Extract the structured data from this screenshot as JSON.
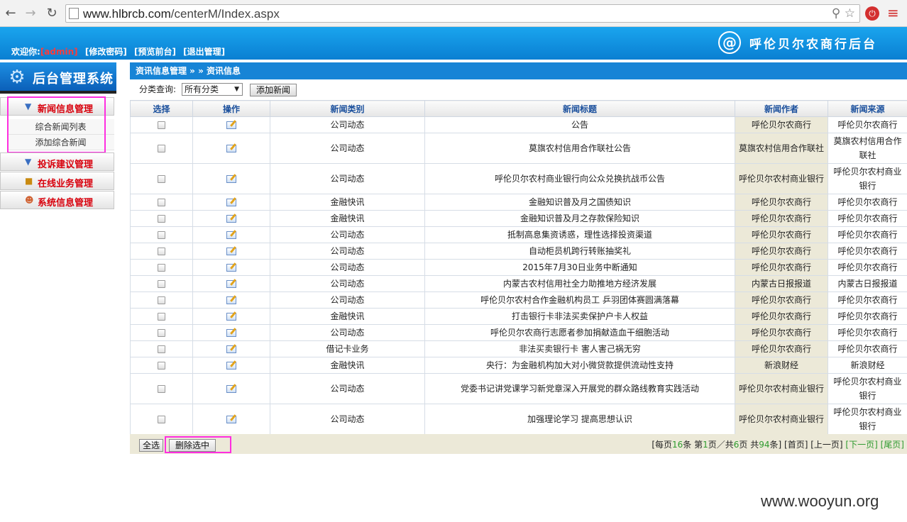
{
  "browser": {
    "url_host": "www.hlbrcb.com",
    "url_path": "/centerM/Index.aspx"
  },
  "header": {
    "welcome_label": "欢迎你:",
    "user_name": "[admin]",
    "links": [
      "[修改密码]",
      "[预览前台]",
      "[退出管理]"
    ],
    "brand_text": "呼伦贝尔农商行后台"
  },
  "sidebar": {
    "title": "后台管理系统",
    "categories": [
      {
        "label": "新闻信息管理",
        "icon": "news-icon"
      },
      {
        "label": "投诉建议管理",
        "icon": "complaint-icon"
      },
      {
        "label": "在线业务管理",
        "icon": "business-icon"
      },
      {
        "label": "系统信息管理",
        "icon": "user-icon"
      }
    ],
    "sub_items": [
      "综合新闻列表",
      "添加综合新闻"
    ]
  },
  "main": {
    "breadcrumb": "资讯信息管理 » » 资讯信息",
    "filter_label": "分类查询:",
    "filter_value": "所有分类",
    "add_button": "添加新闻",
    "columns": [
      "选择",
      "操作",
      "新闻类别",
      "新闻标题",
      "新闻作者",
      "新闻来源"
    ],
    "rows": [
      {
        "category": "公司动态",
        "title": "公告",
        "author": "呼伦贝尔农商行",
        "source": "呼伦贝尔农商行"
      },
      {
        "category": "公司动态",
        "title": "莫旗农村信用合作联社公告",
        "author": "莫旗农村信用合作联社",
        "source": "莫旗农村信用合作联社"
      },
      {
        "category": "公司动态",
        "title": "呼伦贝尔农村商业银行向公众兑换抗战币公告",
        "author": "呼伦贝尔农村商业银行",
        "source": "呼伦贝尔农村商业银行"
      },
      {
        "category": "金融快讯",
        "title": "金融知识普及月之国债知识",
        "author": "呼伦贝尔农商行",
        "source": "呼伦贝尔农商行"
      },
      {
        "category": "金融快讯",
        "title": "金融知识普及月之存款保险知识",
        "author": "呼伦贝尔农商行",
        "source": "呼伦贝尔农商行"
      },
      {
        "category": "公司动态",
        "title": "抵制高息集资诱惑，理性选择投资渠道",
        "author": "呼伦贝尔农商行",
        "source": "呼伦贝尔农商行"
      },
      {
        "category": "公司动态",
        "title": "自动柜员机跨行转账抽奖礼",
        "author": "呼伦贝尔农商行",
        "source": "呼伦贝尔农商行"
      },
      {
        "category": "公司动态",
        "title": "2015年7月30日业务中断通知",
        "author": "呼伦贝尔农商行",
        "source": "呼伦贝尔农商行"
      },
      {
        "category": "公司动态",
        "title": "内蒙古农村信用社全力助推地方经济发展",
        "author": "内蒙古日报报道",
        "source": "内蒙古日报报道"
      },
      {
        "category": "公司动态",
        "title": "呼伦贝尔农村合作金融机构员工 乒羽团体赛圆满落幕",
        "author": "呼伦贝尔农商行",
        "source": "呼伦贝尔农商行"
      },
      {
        "category": "金融快讯",
        "title": "打击银行卡非法买卖保护户卡人权益",
        "author": "呼伦贝尔农商行",
        "source": "呼伦贝尔农商行"
      },
      {
        "category": "公司动态",
        "title": "呼伦贝尔农商行志愿者参加捐献造血干细胞活动",
        "author": "呼伦贝尔农商行",
        "source": "呼伦贝尔农商行"
      },
      {
        "category": "借记卡业务",
        "title": "非法买卖银行卡 害人害己祸无穷",
        "author": "呼伦贝尔农商行",
        "source": "呼伦贝尔农商行"
      },
      {
        "category": "金融快讯",
        "title": "央行：为金融机构加大对小微贷款提供流动性支持",
        "author": "新浪财经",
        "source": "新浪财经"
      },
      {
        "category": "公司动态",
        "title": "党委书记讲党课学习新党章深入开展党的群众路线教育实践活动",
        "author": "呼伦贝尔农村商业银行",
        "source": "呼伦贝尔农村商业银行"
      },
      {
        "category": "公司动态",
        "title": "加强理论学习 提高思想认识",
        "author": "呼伦贝尔农村商业银行",
        "source": "呼伦贝尔农村商业银行"
      }
    ],
    "select_all_button": "全选",
    "delete_selected_button": "删除选中",
    "pager": {
      "per_page": "16",
      "current_page": "1",
      "total_pages": "6",
      "total_items": "94",
      "first": "[首页]",
      "prev": "[上一页]",
      "next": "[下一页]",
      "last": "[尾页]"
    }
  },
  "watermark": "www.wooyun.org",
  "colors": {
    "header_blue": "#0a7fd2",
    "highlight_magenta": "#ff2ee0",
    "menu_red": "#d8000c"
  }
}
